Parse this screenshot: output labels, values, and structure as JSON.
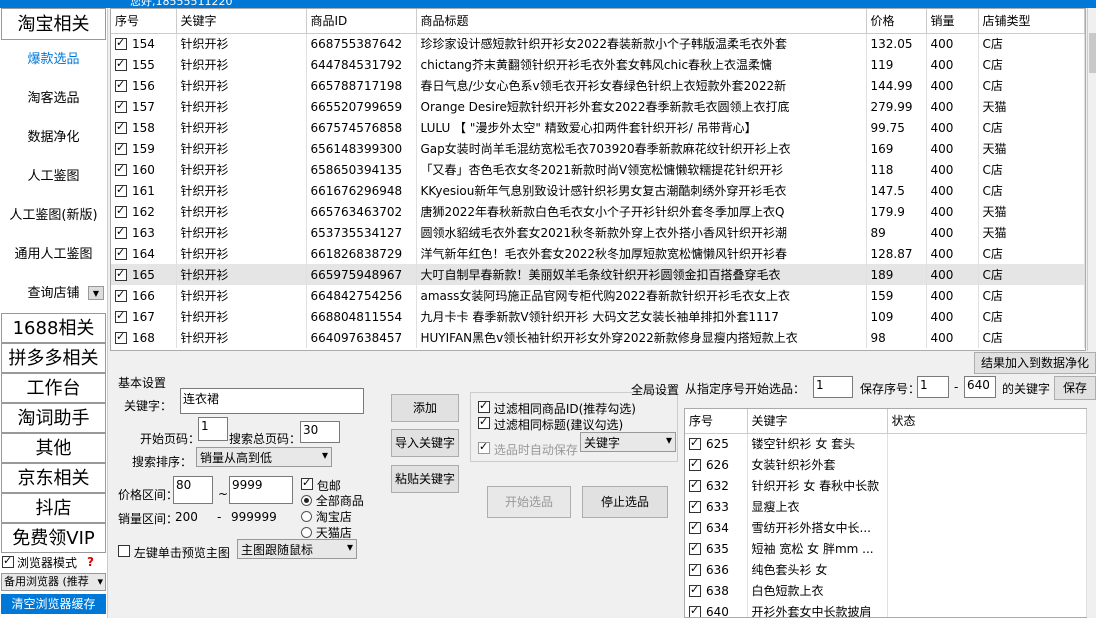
{
  "title_bar": {
    "text": "您好,18555511220"
  },
  "sidebar": {
    "taobao": "淘宝相关",
    "items": [
      "爆款选品",
      "淘客选品",
      "数据净化",
      "人工鉴图",
      "人工鉴图(新版)",
      "通用人工鉴图",
      "查询店铺"
    ],
    "cats": [
      "1688相关",
      "拼多多相关",
      "工作台",
      "淘词助手",
      "其他",
      "京东相关",
      "抖店",
      "免费领VIP"
    ],
    "browser_mode": "浏览器模式",
    "question": "?",
    "backup_browser": "备用浏览器 (推荐",
    "clear_cache": "清空浏览器缓存"
  },
  "table": {
    "headers": [
      "序号",
      "关键字",
      "商品ID",
      "商品标题",
      "价格",
      "销量",
      "店铺类型"
    ],
    "rows": [
      [
        "154",
        "针织开衫",
        "668755387642",
        "珍珍家设计感短款针织开衫女2022春装新款小个子韩版温柔毛衣外套",
        "132.05",
        "400",
        "C店"
      ],
      [
        "155",
        "针织开衫",
        "644784531792",
        "chictang芥末黄翻领针织开衫毛衣外套女韩风chic春秋上衣温柔慵",
        "119",
        "400",
        "C店"
      ],
      [
        "156",
        "针织开衫",
        "665788717198",
        "春日气息/少女心色系v领毛衣开衫女春绿色针织上衣短款外套2022新",
        "144.99",
        "400",
        "C店"
      ],
      [
        "157",
        "针织开衫",
        "665520799659",
        "Orange Desire短款针织开衫外套女2022春季新款毛衣圆领上衣打底",
        "279.99",
        "400",
        "天猫"
      ],
      [
        "158",
        "针织开衫",
        "667574576858",
        "LULU 【 \"漫步外太空\" 精致爱心扣两件套针织开衫/ 吊带背心】",
        "99.75",
        "400",
        "C店"
      ],
      [
        "159",
        "针织开衫",
        "656148399300",
        "Gap女装时尚羊毛混纺宽松毛衣703920春季新款麻花纹针织开衫上衣",
        "169",
        "400",
        "天猫"
      ],
      [
        "160",
        "针织开衫",
        "658650394135",
        "「又春」杏色毛衣女冬2021新款时尚V领宽松慵懒软糯提花针织开衫",
        "118",
        "400",
        "C店"
      ],
      [
        "161",
        "针织开衫",
        "661676296948",
        "KKyesiou新年气息别致设计感针织衫男女复古潮酷刺绣外穿开衫毛衣",
        "147.5",
        "400",
        "C店"
      ],
      [
        "162",
        "针织开衫",
        "665763463702",
        "唐狮2022年春秋新款白色毛衣女小个子开衫针织外套冬季加厚上衣Q",
        "179.9",
        "400",
        "天猫"
      ],
      [
        "163",
        "针织开衫",
        "653735534127",
        "圆领水貂绒毛衣外套女2021秋冬新款外穿上衣外搭小香风针织开衫潮",
        "89",
        "400",
        "天猫"
      ],
      [
        "164",
        "针织开衫",
        "661826838729",
        "洋气新年红色！毛衣外套女2022秋冬加厚短款宽松慵懒风针织开衫春",
        "128.87",
        "400",
        "C店"
      ],
      [
        "165",
        "针织开衫",
        "665975948967",
        "大叮自制早春新款！美丽奴羊毛条纹针织开衫圆领金扣百搭叠穿毛衣",
        "189",
        "400",
        "C店"
      ],
      [
        "166",
        "针织开衫",
        "664842754256",
        "amass女装阿玛施正品官网专柜代购2022春新款针织开衫毛衣女上衣",
        "159",
        "400",
        "C店"
      ],
      [
        "167",
        "针织开衫",
        "668804811554",
        "九月卡卡 春季新款V领针织开衫 大码文艺女装长袖单排扣外套1117",
        "109",
        "400",
        "C店"
      ],
      [
        "168",
        "针织开衫",
        "664097638457",
        "HUYIFAN黑色v领长袖针织开衫女外穿2022新款修身显瘦内搭短款上衣",
        "98",
        "400",
        "C店"
      ]
    ]
  },
  "basic": {
    "title": "基本设置",
    "keyword_label": "关键字：",
    "keyword_value": "连衣裙",
    "start_page_label": "开始页码：",
    "start_page": "1",
    "total_pages_label": "搜索总页码：",
    "total_pages": "30",
    "sort_label": "搜索排序：",
    "sort_value": "销量从高到低",
    "price_label": "价格区间：",
    "price_min": "80",
    "price_max": "9999",
    "sales_label": "销量区间：",
    "sales_min": "200",
    "sales_max": "999999",
    "tilde": "~",
    "dash": "-",
    "baoyou": "包邮",
    "radio_all": "全部商品",
    "radio_taobao": "淘宝店",
    "radio_tmall": "天猫店",
    "left_click": "左键单击预览主图",
    "follow_mouse": "主图跟随鼠标"
  },
  "buttons": {
    "add": "添加",
    "import_kw": "导入关键字",
    "paste_kw": "粘贴关键字",
    "start": "开始选品",
    "stop": "停止选品",
    "add_to_clean": "结果加入到数据净化",
    "save": "保存"
  },
  "filters": {
    "same_id": "过滤相同商品ID(推荐勾选)",
    "same_title": "过滤相同标题(建议勾选)",
    "auto_save": "选品时自动保存",
    "auto_save_select": "关键字"
  },
  "global": {
    "label": "全局设置",
    "from_seq_label": "从指定序号开始选品：",
    "from_seq": "1",
    "save_seq_label": "保存序号：",
    "save_from": "1",
    "save_to": "640",
    "kw_suffix": "的关键字"
  },
  "kw_table": {
    "headers": [
      "序号",
      "关键字",
      "状态"
    ],
    "rows": [
      [
        "625",
        "镂空针织衫 女 套头"
      ],
      [
        "626",
        "女装针织衫外套"
      ],
      [
        "632",
        "针织开衫 女 春秋中长款"
      ],
      [
        "633",
        "显瘦上衣"
      ],
      [
        "634",
        "雪纺开衫外搭女中长..."
      ],
      [
        "635",
        "短袖 宽松 女 胖mm ..."
      ],
      [
        "636",
        "纯色套头衫 女"
      ],
      [
        "638",
        "白色短款上衣"
      ],
      [
        "640",
        "开衫外套女中长款披肩"
      ]
    ]
  }
}
